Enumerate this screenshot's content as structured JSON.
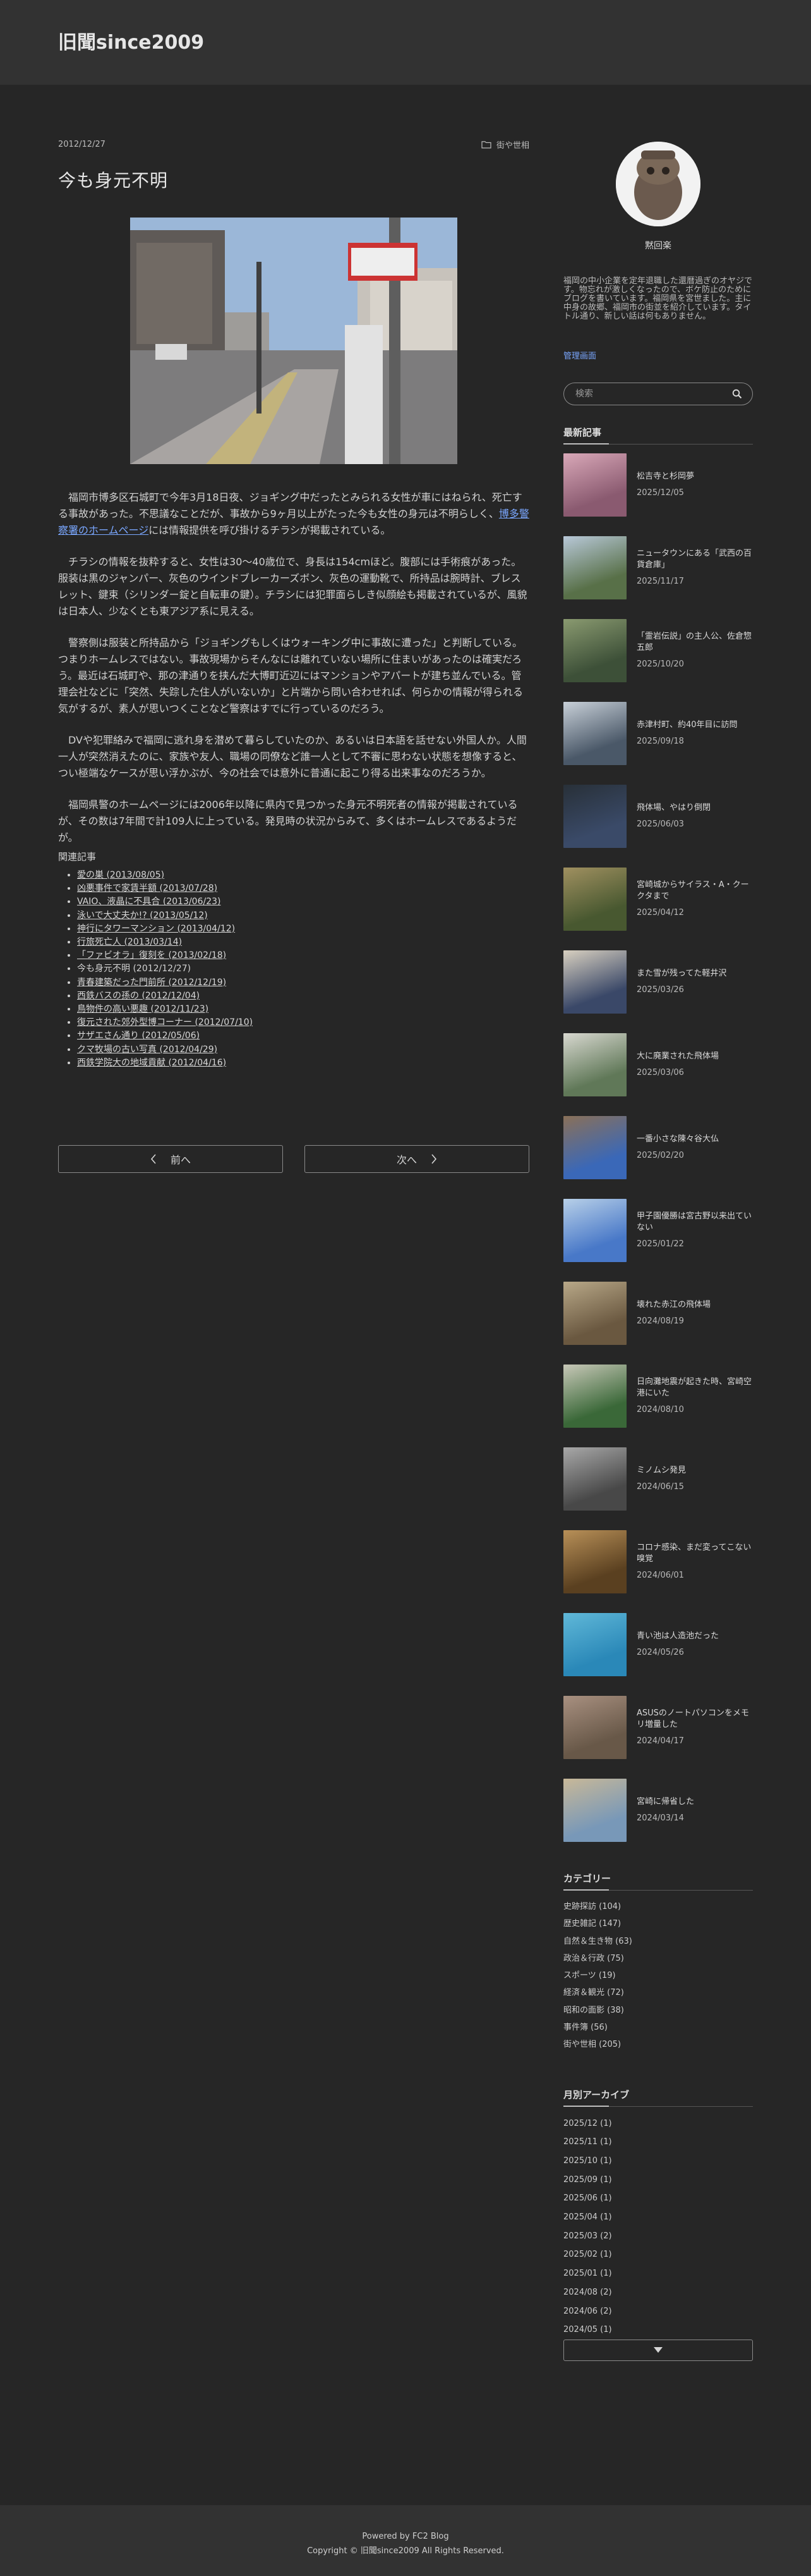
{
  "site": {
    "title": "旧聞since2009"
  },
  "post": {
    "date": "2012/12/27",
    "category": "街や世相",
    "title": "今も身元不明",
    "p1_a": "福岡市博多区石城町で今年3月18日夜、ジョギング中だったとみられる女性が車にはねられ、死亡する事故があった。不思議なことだが、事故から9ヶ月以上がたった今も女性の身元は不明らしく、",
    "p1_link": "博多警察署のホームページ",
    "p1_b": "には情報提供を呼び掛けるチラシが掲載されている。",
    "p2": "チラシの情報を抜粋すると、女性は30〜40歳位で、身長は154cmほど。腹部には手術痕があった。服装は黒のジャンパー、灰色のウインドブレーカーズボン、灰色の運動靴で、所持品は腕時計、ブレスレット、鍵束（シリンダー錠と自転車の鍵）。チラシには犯罪面らしき似顔絵も掲載されているが、風貌は日本人、少なくとも東アジア系に見える。",
    "p3": "警察側は服装と所持品から「ジョギングもしくはウォーキング中に事故に遭った」と判断している。つまりホームレスではない。事故現場からそんなには離れていない場所に住まいがあったのは確実だろう。最近は石城町や、那の津通りを挟んだ大博町近辺にはマンションやアパートが建ち並んでいる。管理会社などに「突然、失踪した住人がいないか」と片端から問い合わせれば、何らかの情報が得られる気がするが、素人が思いつくことなど警察はすでに行っているのだろう。",
    "p4": "DVや犯罪絡みで福岡に逃れ身を潜めて暮らしていたのか、あるいは日本語を話せない外国人か。人間一人が突然消えたのに、家族や友人、職場の同僚など誰一人として不審に思わない状態を想像すると、つい極端なケースが思い浮かぶが、今の社会では意外に普通に起こり得る出来事なのだろうか。",
    "p5": "福岡県警のホームページには2006年以降に県内で見つかった身元不明死者の情報が掲載されているが、その数は7年間で計109人に上っている。発見時の状況からみて、多くはホームレスであるようだが。",
    "related_heading": "関連記事",
    "related": [
      {
        "text": "愛の巣 (2013/08/05)",
        "link": true
      },
      {
        "text": "凶悪事件で家賃半額 (2013/07/28)",
        "link": true
      },
      {
        "text": "VAIO、液晶に不具合 (2013/06/23)",
        "link": true
      },
      {
        "text": "泳いで大丈夫か!? (2013/05/12)",
        "link": true
      },
      {
        "text": "神行にタワーマンション (2013/04/12)",
        "link": true
      },
      {
        "text": "行旅死亡人 (2013/03/14)",
        "link": true
      },
      {
        "text": "「ファビオラ」復刻を (2013/02/18)",
        "link": true
      },
      {
        "text": "今も身元不明 (2012/12/27)",
        "link": false
      },
      {
        "text": "青春建築だった門前所 (2012/12/19)",
        "link": true
      },
      {
        "text": "西鉄バスの孫の (2012/12/04)",
        "link": true
      },
      {
        "text": "鳥物件の高い悪趣 (2012/11/23)",
        "link": true
      },
      {
        "text": "復元された郊外型博コーナー (2012/07/10)",
        "link": true
      },
      {
        "text": "サザエさん通り (2012/05/06)",
        "link": true
      },
      {
        "text": "クマ牧場の古い写真 (2012/04/29)",
        "link": true
      },
      {
        "text": "西鉄学院大の地域貢献 (2012/04/16)",
        "link": true
      }
    ]
  },
  "pager": {
    "prev": "前へ",
    "next": "次へ"
  },
  "sidebar": {
    "profile_name": "黙回楽",
    "profile_desc": "福岡の中小企業を定年退職した還暦過ぎのオヤジです。物忘れが激しくなったので、ボケ防止のためにブログを書いています。福岡県を宮世ました。主に中身の故郷、福岡市の街並を紹介しています。タイトル通り、新しい話は何もありません。",
    "admin_link": "管理画面",
    "search_placeholder": "検索",
    "recent_title": "最新記事",
    "recent": [
      {
        "title": "松吉寺と杉岡夢",
        "date": "2025/12/05",
        "c1": "#8a5a70",
        "c2": "#d9a8b8"
      },
      {
        "title": "ニュータウンにある「武西の百貨倉庫」",
        "date": "2025/11/17",
        "c1": "#587048",
        "c2": "#b8c8d8"
      },
      {
        "title": "「霊岩伝説」の主人公、佐倉惣五郎",
        "date": "2025/10/20",
        "c1": "#3d5038",
        "c2": "#8a9a70"
      },
      {
        "title": "赤津村町、約40年目に訪問",
        "date": "2025/09/18",
        "c1": "#4a5868",
        "c2": "#c8d0d8"
      },
      {
        "title": "飛体場、やはり倒閉",
        "date": "2025/06/03",
        "c1": "#3a4a68",
        "c2": "#283038"
      },
      {
        "title": "宮崎城からサイラス・A・クークタまで",
        "date": "2025/04/12",
        "c1": "#485830",
        "c2": "#a09060"
      },
      {
        "title": "また雪が残ってた軽井沢",
        "date": "2025/03/26",
        "c1": "#3a4868",
        "c2": "#d8d0c0"
      },
      {
        "title": "大に廃業された飛体場",
        "date": "2025/03/06",
        "c1": "#607858",
        "c2": "#d8d8d0"
      },
      {
        "title": "一番小さな陳々谷大仏",
        "date": "2025/02/20",
        "c1": "#3a68b8",
        "c2": "#8a7058"
      },
      {
        "title": "甲子園優勝は宮古野以来出ていない",
        "date": "2025/01/22",
        "c1": "#4878c8",
        "c2": "#b8d0e8"
      },
      {
        "title": "壊れた赤江の飛体場",
        "date": "2024/08/19",
        "c1": "#6a5840",
        "c2": "#b8a888"
      },
      {
        "title": "日向灘地震が起きた時、宮崎空港にいた",
        "date": "2024/08/10",
        "c1": "#3a6838",
        "c2": "#c8c8b8"
      },
      {
        "title": "ミノムシ発見",
        "date": "2024/06/15",
        "c1": "#484848",
        "c2": "#a8a8a8"
      },
      {
        "title": "コロナ感染、まだ変ってこない嗅覚",
        "date": "2024/06/01",
        "c1": "#5a4020",
        "c2": "#b89058"
      },
      {
        "title": "青い池は人造池だった",
        "date": "2024/05/26",
        "c1": "#2a88b8",
        "c2": "#60b8d8"
      },
      {
        "title": "ASUSのノートパソコンをメモリ増量した",
        "date": "2024/04/17",
        "c1": "#685848",
        "c2": "#a89080"
      },
      {
        "title": "宮崎に帰省した",
        "date": "2024/03/14",
        "c1": "#7898b8",
        "c2": "#c8b898"
      }
    ],
    "categories_title": "カテゴリー",
    "categories": [
      "史跡探訪 (104)",
      "歴史雑記 (147)",
      "自然＆生き物 (63)",
      "政治＆行政 (75)",
      "スポーツ (19)",
      "経済＆観光 (72)",
      "昭和の面影 (38)",
      "事件簿 (56)",
      "街や世相 (205)"
    ],
    "archive_title": "月別アーカイブ",
    "archive": [
      "2025/12 (1)",
      "2025/11 (1)",
      "2025/10 (1)",
      "2025/09 (1)",
      "2025/06 (1)",
      "2025/04 (1)",
      "2025/03 (2)",
      "2025/02 (1)",
      "2025/01 (1)",
      "2024/08 (2)",
      "2024/06 (2)",
      "2024/05 (1)"
    ]
  },
  "footer": {
    "powered": "Powered by FC2 Blog",
    "copyright": "Copyright © 旧聞since2009 All Rights Reserved."
  }
}
